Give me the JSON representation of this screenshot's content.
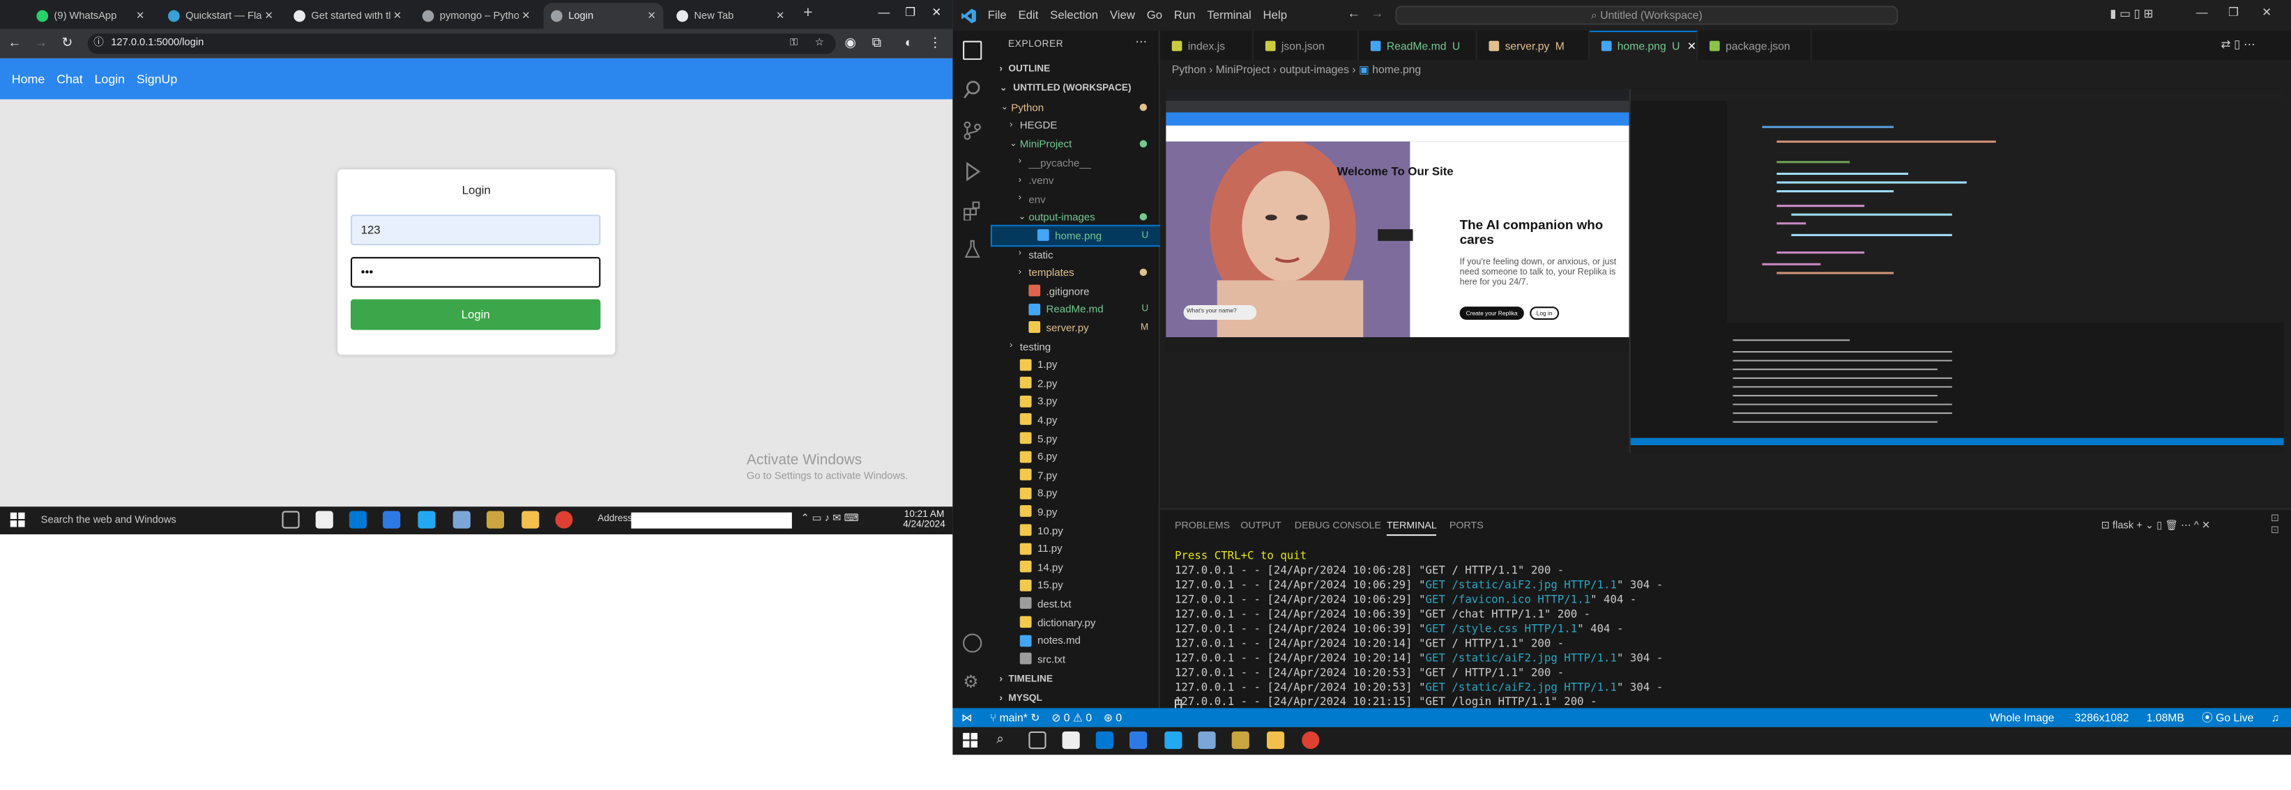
{
  "chrome": {
    "tabs": [
      {
        "label": "(9) WhatsApp",
        "color": "#25d366"
      },
      {
        "label": "Quickstart — Flask D",
        "color": "#3aa0d8"
      },
      {
        "label": "Get started with the",
        "color": "#e8eaed"
      },
      {
        "label": "pymongo – Python d",
        "color": "#9aa0a6"
      },
      {
        "label": "Login",
        "color": "#9aa0a6"
      },
      {
        "label": "New Tab",
        "color": "#e8eaed"
      }
    ],
    "new_tab": "+",
    "address": "127.0.0.1:5000/login",
    "nav": [
      "Home",
      "Chat",
      "Login",
      "SignUp"
    ],
    "login": {
      "title": "Login",
      "username_value": "123",
      "password_value": "•••",
      "button": "Login"
    },
    "activate_line1": "Activate Windows",
    "activate_line2": "Go to Settings to activate Windows."
  },
  "taskbar_left": {
    "search_placeholder": "Search the web and Windows",
    "address_label": "Address",
    "time": "10:21 AM",
    "date": "4/24/2024"
  },
  "vscode": {
    "menu": [
      "File",
      "Edit",
      "Selection",
      "View",
      "Go",
      "Run",
      "Terminal",
      "Help"
    ],
    "command_center": "Untitled (Workspace)",
    "explorer_title": "EXPLORER",
    "outline": "OUTLINE",
    "workspace": "UNTITLED (WORKSPACE)",
    "tree": [
      {
        "label": "Python",
        "depth": 0,
        "color": "#e2c08d",
        "kind": "folder-open",
        "dot": true
      },
      {
        "label": "HEGDE",
        "depth": 1,
        "color": "#cccccc",
        "kind": "folder"
      },
      {
        "label": "MiniProject",
        "depth": 1,
        "color": "#73c991",
        "kind": "folder-open",
        "dot": true
      },
      {
        "label": "__pycache__",
        "depth": 2,
        "color": "#8c8c8c",
        "kind": "folder"
      },
      {
        "label": ".venv",
        "depth": 2,
        "color": "#8c8c8c",
        "kind": "folder"
      },
      {
        "label": "env",
        "depth": 2,
        "color": "#8c8c8c",
        "kind": "folder"
      },
      {
        "label": "output-images",
        "depth": 2,
        "color": "#73c991",
        "kind": "folder-open",
        "dot": true
      },
      {
        "label": "home.png",
        "depth": 3,
        "color": "#73c991",
        "kind": "image",
        "badge": "U",
        "selected": true
      },
      {
        "label": "static",
        "depth": 2,
        "color": "#cccccc",
        "kind": "folder"
      },
      {
        "label": "templates",
        "depth": 2,
        "color": "#e2c08d",
        "kind": "folder",
        "dot": true
      },
      {
        "label": ".gitignore",
        "depth": 2,
        "color": "#cccccc",
        "kind": "git"
      },
      {
        "label": "ReadMe.md",
        "depth": 2,
        "color": "#73c991",
        "kind": "md",
        "badge": "U"
      },
      {
        "label": "server.py",
        "depth": 2,
        "color": "#e2c08d",
        "kind": "py",
        "badge": "M"
      },
      {
        "label": "testing",
        "depth": 1,
        "color": "#cccccc",
        "kind": "folder"
      },
      {
        "label": "1.py",
        "depth": 1,
        "color": "#cccccc",
        "kind": "py"
      },
      {
        "label": "2.py",
        "depth": 1,
        "color": "#cccccc",
        "kind": "py"
      },
      {
        "label": "3.py",
        "depth": 1,
        "color": "#cccccc",
        "kind": "py"
      },
      {
        "label": "4.py",
        "depth": 1,
        "color": "#cccccc",
        "kind": "py"
      },
      {
        "label": "5.py",
        "depth": 1,
        "color": "#cccccc",
        "kind": "py"
      },
      {
        "label": "6.py",
        "depth": 1,
        "color": "#cccccc",
        "kind": "py"
      },
      {
        "label": "7.py",
        "depth": 1,
        "color": "#cccccc",
        "kind": "py"
      },
      {
        "label": "8.py",
        "depth": 1,
        "color": "#cccccc",
        "kind": "py"
      },
      {
        "label": "9.py",
        "depth": 1,
        "color": "#cccccc",
        "kind": "py"
      },
      {
        "label": "10.py",
        "depth": 1,
        "color": "#cccccc",
        "kind": "py"
      },
      {
        "label": "11.py",
        "depth": 1,
        "color": "#cccccc",
        "kind": "py"
      },
      {
        "label": "14.py",
        "depth": 1,
        "color": "#cccccc",
        "kind": "py"
      },
      {
        "label": "15.py",
        "depth": 1,
        "color": "#cccccc",
        "kind": "py"
      },
      {
        "label": "dest.txt",
        "depth": 1,
        "color": "#cccccc",
        "kind": "txt"
      },
      {
        "label": "dictionary.py",
        "depth": 1,
        "color": "#cccccc",
        "kind": "py"
      },
      {
        "label": "notes.md",
        "depth": 1,
        "color": "#cccccc",
        "kind": "md"
      },
      {
        "label": "src.txt",
        "depth": 1,
        "color": "#cccccc",
        "kind": "txt"
      }
    ],
    "timeline": "TIMELINE",
    "mysql": "MYSQL",
    "tabs": [
      {
        "label": "index.js",
        "color": "#cbcb41",
        "status": ""
      },
      {
        "label": "json.json",
        "color": "#cbcb41",
        "status": ""
      },
      {
        "label": "ReadMe.md",
        "color": "#42a5f5",
        "status": "U"
      },
      {
        "label": "server.py",
        "color": "#e2c08d",
        "status": "M"
      },
      {
        "label": "home.png",
        "color": "#42a5f5",
        "status": "U",
        "active": true
      },
      {
        "label": "package.json",
        "color": "#8bc34a",
        "status": ""
      }
    ],
    "breadcrumb": [
      "Python",
      "MiniProject",
      "output-images",
      "home.png"
    ],
    "preview": {
      "welcome": "Welcome To Our Site",
      "headline": "The AI companion who cares",
      "body": "If you're feeling down, or anxious, or just need someone to talk to, your Replika is here for you 24/7.",
      "create_btn": "Create your Replika",
      "login_btn": "Log in",
      "ask": "What's your name?"
    },
    "panel_tabs": [
      "PROBLEMS",
      "OUTPUT",
      "DEBUG CONSOLE",
      "TERMINAL",
      "PORTS"
    ],
    "terminal_shell": "flask",
    "terminal": [
      {
        "pre": "Press CTRL+C to quit",
        "url": "",
        "post": ""
      },
      {
        "pre": "127.0.0.1 - - [24/Apr/2024 10:06:28] \"GET / HTTP/1.1\" 200 -",
        "url": "",
        "post": ""
      },
      {
        "pre": "127.0.0.1 - - [24/Apr/2024 10:06:29] \"",
        "url": "GET /static/aiF2.jpg HTTP/1.1",
        "post": "\" 304 -"
      },
      {
        "pre": "127.0.0.1 - - [24/Apr/2024 10:06:29] \"",
        "url": "GET /favicon.ico HTTP/1.1",
        "post": "\" 404 -"
      },
      {
        "pre": "127.0.0.1 - - [24/Apr/2024 10:06:39] \"GET /chat HTTP/1.1\" 200 -",
        "url": "",
        "post": ""
      },
      {
        "pre": "127.0.0.1 - - [24/Apr/2024 10:06:39] \"",
        "url": "GET /style.css HTTP/1.1",
        "post": "\" 404 -"
      },
      {
        "pre": "127.0.0.1 - - [24/Apr/2024 10:20:14] \"GET / HTTP/1.1\" 200 -",
        "url": "",
        "post": ""
      },
      {
        "pre": "127.0.0.1 - - [24/Apr/2024 10:20:14] \"",
        "url": "GET /static/aiF2.jpg HTTP/1.1",
        "post": "\" 304 -"
      },
      {
        "pre": "127.0.0.1 - - [24/Apr/2024 10:20:53] \"GET / HTTP/1.1\" 200 -",
        "url": "",
        "post": ""
      },
      {
        "pre": "127.0.0.1 - - [24/Apr/2024 10:20:53] \"",
        "url": "GET /static/aiF2.jpg HTTP/1.1",
        "post": "\" 304 -"
      },
      {
        "pre": "127.0.0.1 - - [24/Apr/2024 10:21:15] \"GET /login HTTP/1.1\" 200 -",
        "url": "",
        "post": ""
      }
    ],
    "status": {
      "branch": "main*",
      "problems": "⊘ 0 ⚠ 0",
      "ports": "0",
      "image_kind": "Whole Image",
      "dimensions": "3286x1082",
      "size": "1.08MB",
      "golive": "Go Live"
    }
  },
  "colors": {
    "vscode_blue": "#007acc",
    "nav_blue": "#2b87ee",
    "login_green": "#3ba74a"
  }
}
